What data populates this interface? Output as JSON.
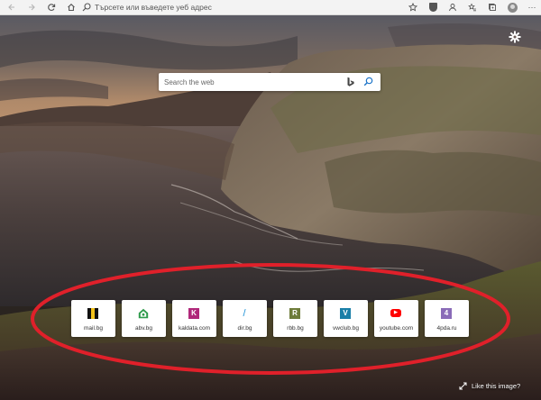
{
  "toolbar": {
    "back_icon": "back-arrow-icon",
    "forward_icon": "forward-arrow-icon",
    "refresh_icon": "refresh-icon",
    "home_icon": "home-icon",
    "address_placeholder": "Търсете или въведете уеб адрес",
    "right_icons": [
      "star-icon",
      "shield-icon",
      "profile-icon",
      "favorites-icon",
      "collections-icon",
      "avatar",
      "more-icon"
    ]
  },
  "search": {
    "placeholder": "Search the web",
    "engine_icon": "bing-icon",
    "button_icon": "search-icon"
  },
  "settings_icon": "gear-icon",
  "tiles": [
    {
      "label": "mail.bg",
      "glyph": "",
      "color": "#111111"
    },
    {
      "label": "abv.bg",
      "glyph": "",
      "color": "#2e9b4b"
    },
    {
      "label": "kaldata.com",
      "glyph": "K",
      "color": "#b0287a"
    },
    {
      "label": "dir.bg",
      "glyph": "/",
      "color": "#1a8fd6"
    },
    {
      "label": "rbb.bg",
      "glyph": "R",
      "color": "#6e7c3a"
    },
    {
      "label": "vwclub.bg",
      "glyph": "V",
      "color": "#1a7fa8"
    },
    {
      "label": "youtube.com",
      "glyph": "▶",
      "color": "#ff0000"
    },
    {
      "label": "4pda.ru",
      "glyph": "4",
      "color": "#8a6bb8"
    }
  ],
  "like_image": {
    "label": "Like this image?",
    "icon": "expand-arrows-icon"
  },
  "colors": {
    "annotation_ellipse": "#e0202a",
    "toolbar_bg": "#f3f3f3"
  }
}
